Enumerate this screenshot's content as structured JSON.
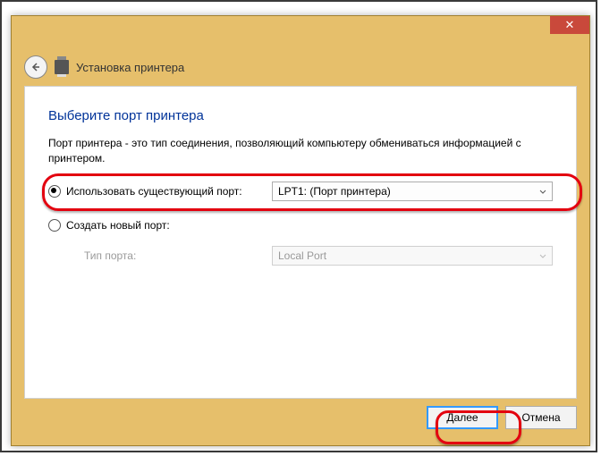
{
  "header": {
    "wizard_title": "Установка принтера"
  },
  "content": {
    "heading": "Выберите порт принтера",
    "description": "Порт принтера - это тип соединения, позволяющий компьютеру обмениваться информацией с принтером.",
    "option_existing": {
      "label": "Использовать существующий порт:",
      "value": "LPT1: (Порт принтера)",
      "checked": true
    },
    "option_new": {
      "label": "Создать новый порт:",
      "type_label": "Тип порта:",
      "type_value": "Local Port",
      "checked": false
    }
  },
  "buttons": {
    "next": "Далее",
    "cancel": "Отмена"
  }
}
